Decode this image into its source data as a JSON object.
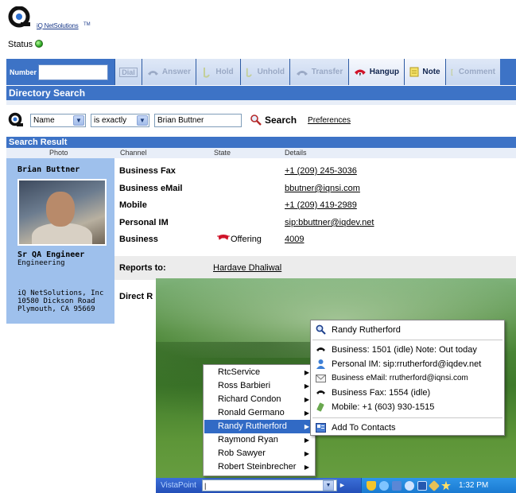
{
  "brand": {
    "logo_text": "iQ NetSolutions",
    "logo_tm": "TM"
  },
  "status": {
    "label": "Status",
    "color": "#27a31c"
  },
  "toolbar": {
    "number_label": "Number",
    "number_value": "",
    "buttons": [
      {
        "label": "Dial",
        "icon": "dial-icon",
        "enabled": false
      },
      {
        "label": "Answer",
        "icon": "answer-icon",
        "enabled": false
      },
      {
        "label": "Hold",
        "icon": "hold-icon",
        "enabled": false
      },
      {
        "label": "Unhold",
        "icon": "unhold-icon",
        "enabled": false
      },
      {
        "label": "Transfer",
        "icon": "transfer-icon",
        "enabled": false
      },
      {
        "label": "Hangup",
        "icon": "hangup-icon",
        "enabled": true
      },
      {
        "label": "Note",
        "icon": "note-icon",
        "enabled": true
      },
      {
        "label": "Comment",
        "icon": "comment-icon",
        "enabled": false
      }
    ]
  },
  "directory": {
    "title": "Directory Search",
    "field_select": "Name",
    "operator_select": "is exactly",
    "query": "Brian Buttner",
    "search_label": "Search",
    "preferences_label": "Preferences"
  },
  "result": {
    "title": "Search Result",
    "columns": {
      "photo": "Photo",
      "channel": "Channel",
      "state": "State",
      "details": "Details"
    },
    "person": {
      "name": "Brian Buttner",
      "title": "Sr QA Engineer",
      "department": "Engineering",
      "address": [
        "iQ NetSolutions, Inc",
        "10580 Dickson Road",
        "Plymouth, CA  95669"
      ]
    },
    "rows": [
      {
        "channel": "Business Fax",
        "state": "",
        "detail": "+1 (209) 245-3036"
      },
      {
        "channel": "Business eMail",
        "state": "",
        "detail": "bbutner@iqnsi.com"
      },
      {
        "channel": "Mobile",
        "state": "",
        "detail": "+1 (209) 419-2989"
      },
      {
        "channel": "Personal IM",
        "state": "",
        "detail": "sip:bbuttner@iqdev.net"
      },
      {
        "channel": "Business",
        "state": "Offering",
        "detail": "4009"
      }
    ],
    "reports_to_label": "Reports to:",
    "reports_to_value": "Hardave Dhaliwal",
    "direct_label": "Direct R"
  },
  "taskbar": {
    "label": "VistaPoint",
    "input_value": "|",
    "clock": "1:32 PM",
    "accent": "#2a5bc4"
  },
  "context_menu": {
    "items": [
      {
        "label": "RtcService",
        "highlighted": false
      },
      {
        "label": "Ross Barbieri",
        "highlighted": false
      },
      {
        "label": "Richard Condon",
        "highlighted": false
      },
      {
        "label": "Ronald Germano",
        "highlighted": false
      },
      {
        "label": "Randy Rutherford",
        "highlighted": true
      },
      {
        "label": "Raymond Ryan",
        "highlighted": false
      },
      {
        "label": "Rob Sawyer",
        "highlighted": false
      },
      {
        "label": "Robert Steinbrecher",
        "highlighted": false
      }
    ]
  },
  "contact_popup": {
    "name": "Randy Rutherford",
    "business": "Business: 1501 (idle) Note: Out today",
    "personal_im": "Personal IM: sip:rrutherford@iqdev.net",
    "business_email": "Business eMail: rrutherford@iqnsi.com",
    "business_fax": "Business Fax: 1554 (idle)",
    "mobile": "Mobile: +1 (603) 930-1515",
    "add_to_contacts": "Add To Contacts"
  }
}
